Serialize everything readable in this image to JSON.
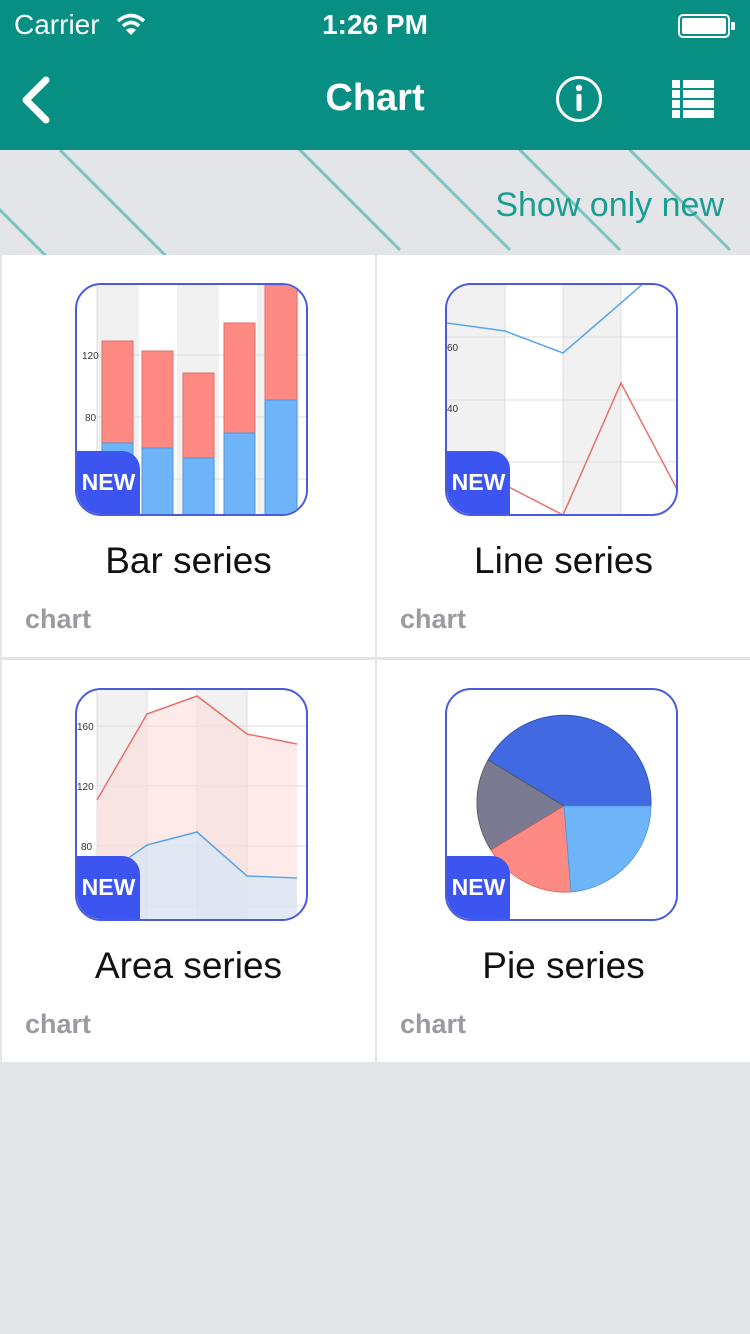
{
  "status_bar": {
    "carrier": "Carrier",
    "time": "1:26 PM"
  },
  "nav": {
    "title": "Chart",
    "back_icon": "chevron-left-icon",
    "info_icon": "info-circle-icon",
    "list_icon": "list-icon"
  },
  "filter": {
    "label": "Show only new"
  },
  "colors": {
    "accent": "#078f84",
    "badge": "#3d55f0",
    "bar_red": "#fd8b84",
    "bar_blue": "#6db4f8",
    "pie_dark_blue": "#4169e1",
    "pie_gray": "#7a7a92"
  },
  "cards": [
    {
      "name": "Bar series",
      "category": "chart",
      "badge": "NEW",
      "axis_labels": [
        "120",
        "80"
      ]
    },
    {
      "name": "Line series",
      "category": "chart",
      "badge": "NEW",
      "axis_labels": [
        "60",
        "40"
      ]
    },
    {
      "name": "Area series",
      "category": "chart",
      "badge": "NEW",
      "axis_labels": [
        "160",
        "120",
        "80"
      ]
    },
    {
      "name": "Pie series",
      "category": "chart",
      "badge": "NEW"
    }
  ]
}
